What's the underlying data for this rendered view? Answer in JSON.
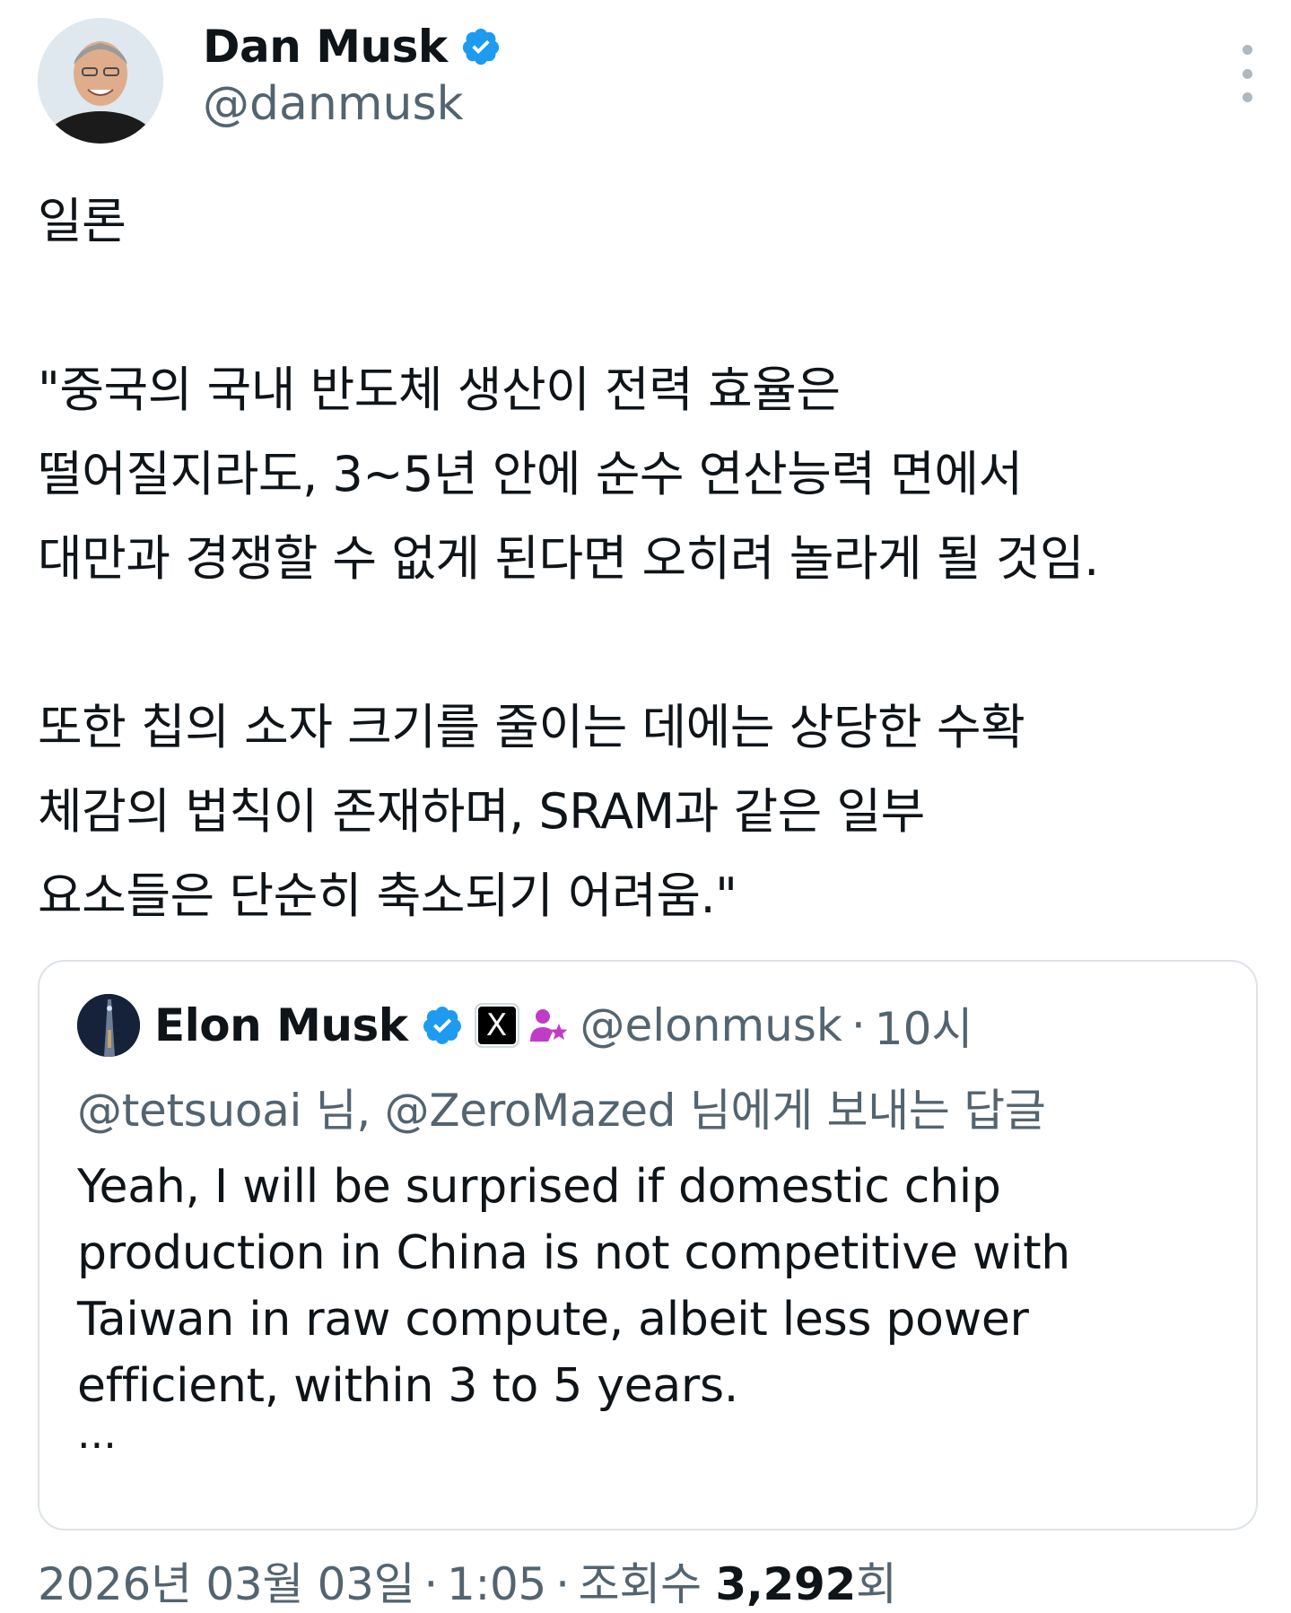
{
  "author": {
    "display_name": "Dan Musk",
    "handle": "@danmusk",
    "verified": true
  },
  "post": {
    "paragraphs": [
      "일론",
      "\"중국의 국내 반도체 생산이 전력 효율은\n떨어질지라도, 3~5년 안에 순수 연산능력 면에서\n대만과 경쟁할 수 없게 된다면 오히려 놀라게 될 것임.",
      "또한 칩의 소자 크기를 줄이는 데에는 상당한 수확\n체감의 법칙이 존재하며, SRAM과 같은 일부\n요소들은 단순히 축소되기 어려움.\""
    ]
  },
  "quoted": {
    "display_name": "Elon Musk",
    "verified": true,
    "affiliate_badge": "X",
    "handle": "@elonmusk",
    "separator": "·",
    "time": "10시",
    "reply_context": "@tetsuoai 님, @ZeroMazed 님에게 보내는 답글",
    "text": "Yeah, I will be surprised if domestic chip\nproduction in China is not competitive with\nTaiwan in raw compute, albeit less power\nefficient, within 3 to 5 years.",
    "more": "..."
  },
  "meta": {
    "date": "2026년 03월 03일",
    "sep1": "·",
    "time": "1:05",
    "sep2": "·",
    "views_label": "조회수",
    "views_count": "3,292",
    "views_suffix": "회"
  },
  "colors": {
    "verified_blue": "#1d9bf0",
    "secondary_text": "#536471",
    "border": "#dde3e8",
    "subscriber_purple": "#c13cc6"
  },
  "icons": {
    "verified": "verified-badge-icon",
    "more": "more-options-icon",
    "x_logo": "x-logo-icon",
    "subscriber": "person-star-icon"
  }
}
